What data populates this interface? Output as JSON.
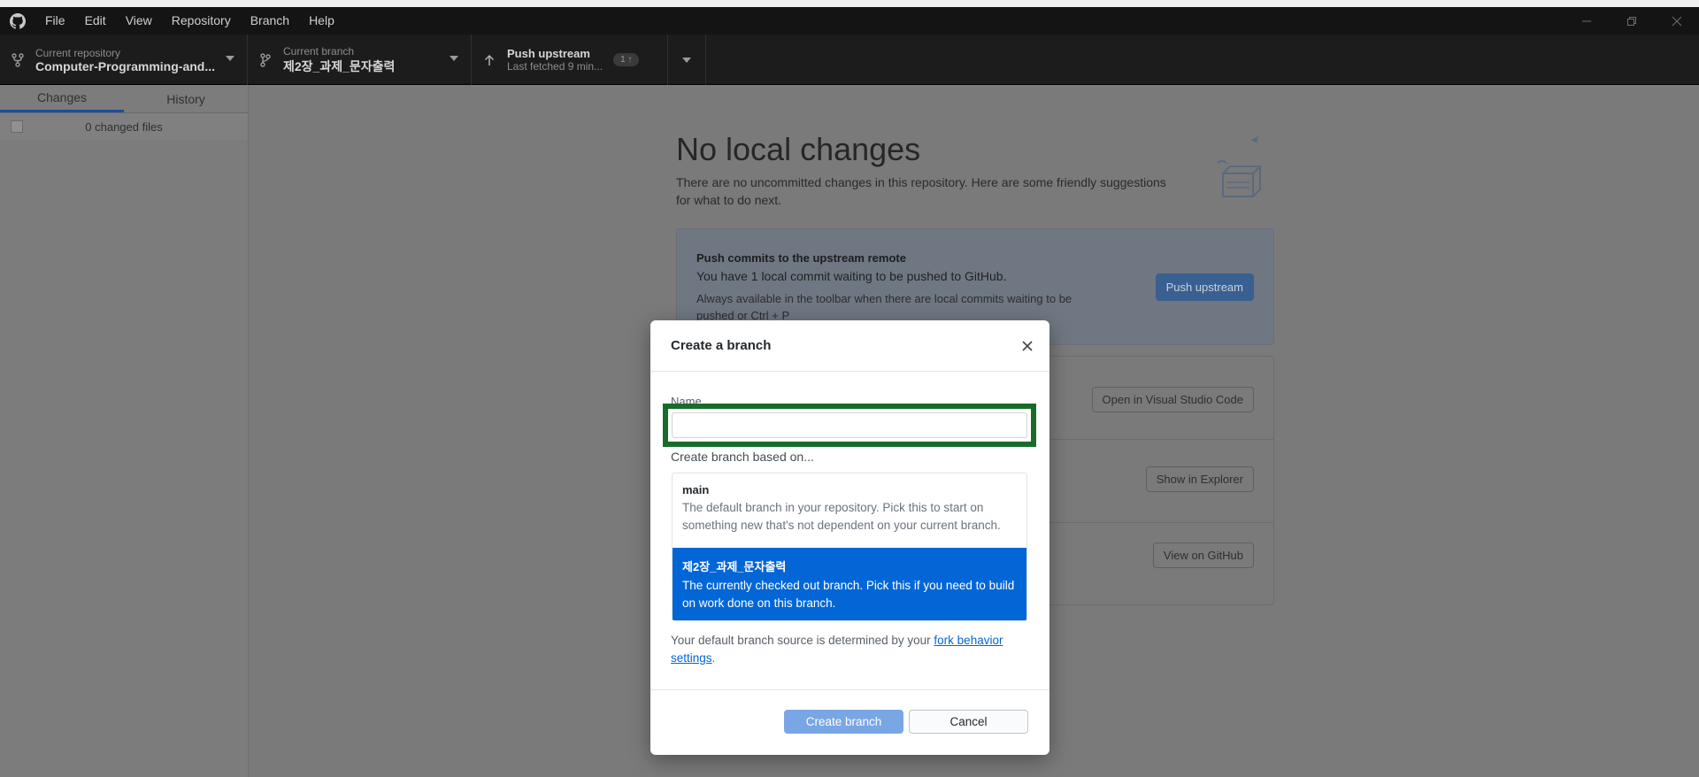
{
  "menu": [
    "File",
    "Edit",
    "View",
    "Repository",
    "Branch",
    "Help"
  ],
  "toolbar": {
    "repo_label": "Current repository",
    "repo_value": "Computer-Programming-and...",
    "branch_label": "Current branch",
    "branch_value": "제2장_과제_문자출력",
    "push_label": "Push upstream",
    "push_sub": "Last fetched 9 min...",
    "push_badge": "1 ↑"
  },
  "sidebar": {
    "tabs": [
      "Changes",
      "History"
    ],
    "changed_files": "0 changed files"
  },
  "main": {
    "title": "No local changes",
    "description": "There are no uncommitted changes in this repository. Here are some friendly suggestions for what to do next.",
    "push_box": {
      "title": "Push commits to the upstream remote",
      "desc": "You have 1 local commit waiting to be pushed to GitHub.",
      "note": "Always available in the toolbar when there are local commits waiting to be pushed or  Ctrl + P",
      "button": "Push upstream"
    },
    "actions": [
      "Open in Visual Studio Code",
      "Show in Explorer",
      "View on GitHub"
    ]
  },
  "dialog": {
    "title": "Create a branch",
    "name_label": "Name",
    "name_value": "",
    "based_label": "Create branch based on...",
    "branches": [
      {
        "name": "main",
        "desc": "The default branch in your repository. Pick this to start on something new that's not dependent on your current branch."
      },
      {
        "name": "제2장_과제_문자출력",
        "desc": "The currently checked out branch. Pick this if you need to build on work done on this branch."
      }
    ],
    "fork_note_prefix": "Your default branch source is determined by your ",
    "fork_link": "fork behavior settings",
    "fork_note_suffix": ".",
    "create_button": "Create branch",
    "cancel_button": "Cancel"
  },
  "colors": {
    "accent": "#0366d6",
    "highlight_box": "#1a6b2a",
    "create_button": "#79a6e4"
  }
}
